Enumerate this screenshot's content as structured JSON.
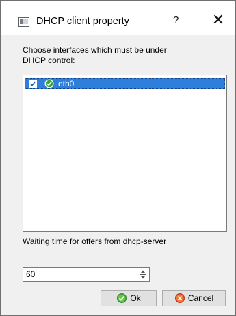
{
  "window": {
    "title": "DHCP client property",
    "help_glyph": "?",
    "close_glyph": "✕"
  },
  "interfaces": {
    "label": "Choose interfaces which must be under DHCP control:",
    "items": [
      {
        "label": "eth0",
        "checked": true,
        "selected": true,
        "status_icon": "check-circle-icon"
      }
    ]
  },
  "waiting": {
    "label": "Waiting time for offers from dhcp-server",
    "value": "60"
  },
  "buttons": {
    "ok_label": "Ok",
    "cancel_label": "Cancel"
  },
  "colors": {
    "selection": "#2e7fdc",
    "ok_icon": "#2f8f2f",
    "cancel_icon": "#d24a1e"
  }
}
